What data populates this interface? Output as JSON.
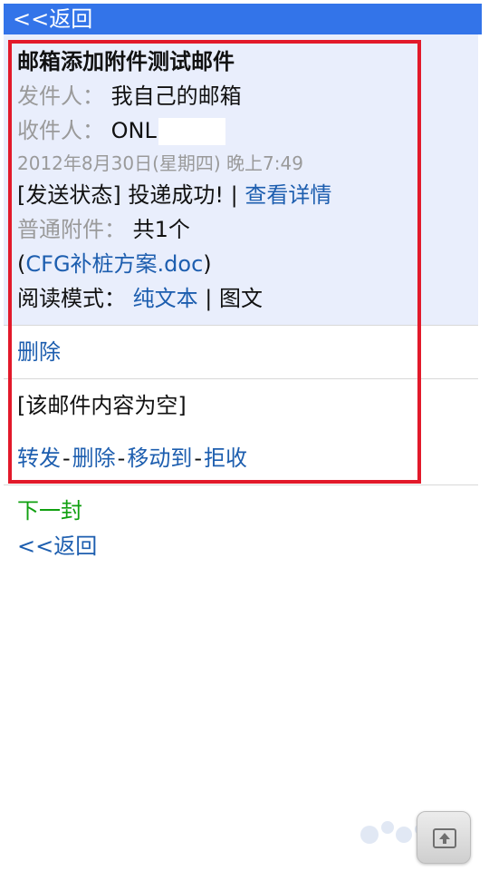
{
  "top_bar": {
    "back_label": "<<返回",
    "background": "#3374e9"
  },
  "mail": {
    "subject": "邮箱添加附件测试邮件",
    "from_label": "发件人：",
    "from_value": "我自己的邮箱",
    "to_label": "收件人：",
    "to_value": "ONL",
    "datetime": "2012年8月30日(星期四) 晚上7:49",
    "status_prefix": "[发送状态]",
    "status_value": "投递成功!",
    "status_sep": " | ",
    "view_details": "查看详情",
    "attachment_label": "普通附件：",
    "attachment_count": "共1个",
    "attachment_open": "(",
    "attachment_name": "CFG补桩方案.doc",
    "attachment_close": ")",
    "read_mode_label": "阅读模式：",
    "read_mode_plain": "纯文本",
    "read_mode_sep": " | ",
    "read_mode_rich": "图文"
  },
  "actions_top": {
    "delete": "删除"
  },
  "body": {
    "empty_text": "[该邮件内容为空]"
  },
  "actions_bottom": {
    "forward": "转发",
    "delete": "删除",
    "move_to": "移动到",
    "reject": "拒收",
    "separator": "-"
  },
  "nav": {
    "next": "下一封",
    "back": "<<返回"
  },
  "colors": {
    "link": "#1d5eaf",
    "header_bg": "#e9eefc",
    "highlight_frame": "#e2192a",
    "next_link": "#10a010"
  },
  "icons": {
    "floating_button": "scroll-to-top-icon"
  }
}
